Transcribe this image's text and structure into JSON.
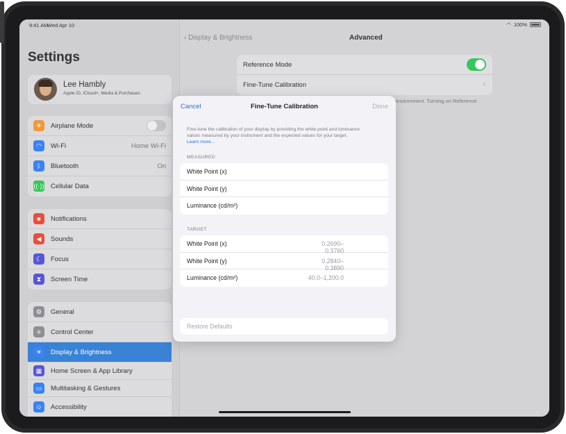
{
  "status_bar": {
    "time": "9:41 AM",
    "date": "Wed Apr 10",
    "battery": "100%"
  },
  "sidebar": {
    "title": "Settings",
    "profile": {
      "name": "Lee Hambly",
      "subtitle": "Apple ID, iCloud+, Media & Purchases"
    },
    "group1": [
      {
        "label": "Airplane Mode",
        "icon": "airplane-icon",
        "color": "#f09a37",
        "toggle": false
      },
      {
        "label": "Wi-Fi",
        "icon": "wifi-icon",
        "color": "#3a82f6",
        "value": "Home Wi-Fi"
      },
      {
        "label": "Bluetooth",
        "icon": "bluetooth-icon",
        "color": "#3a82f6",
        "value": "On"
      },
      {
        "label": "Cellular Data",
        "icon": "cellular-icon",
        "color": "#34c759"
      }
    ],
    "group2": [
      {
        "label": "Notifications",
        "icon": "bell-icon",
        "color": "#eb4d3d"
      },
      {
        "label": "Sounds",
        "icon": "speaker-icon",
        "color": "#eb4d3d"
      },
      {
        "label": "Focus",
        "icon": "moon-icon",
        "color": "#5856d6"
      },
      {
        "label": "Screen Time",
        "icon": "hourglass-icon",
        "color": "#5856d6"
      }
    ],
    "group3": [
      {
        "label": "General",
        "icon": "gear-icon",
        "color": "#8e8e93"
      },
      {
        "label": "Control Center",
        "icon": "toggles-icon",
        "color": "#8e8e93"
      },
      {
        "label": "Display & Brightness",
        "icon": "sun-icon",
        "color": "#3a82f6",
        "selected": true
      },
      {
        "label": "Home Screen & App Library",
        "icon": "grid-icon",
        "color": "#5856d6"
      },
      {
        "label": "Multitasking & Gestures",
        "icon": "multitask-icon",
        "color": "#3a82f6"
      },
      {
        "label": "Accessibility",
        "icon": "accessibility-icon",
        "color": "#3a82f6"
      }
    ]
  },
  "detail": {
    "back_label": "Display & Brightness",
    "title": "Advanced",
    "reference_mode_label": "Reference Mode",
    "reference_mode_on": true,
    "fine_tune_label": "Fine-Tune Calibration",
    "footnote": "environment. Turning on Reference"
  },
  "modal": {
    "cancel": "Cancel",
    "title": "Fine-Tune Calibration",
    "done": "Done",
    "description": "Fine-tune the calibration of your display by providing the white point and luminance values measured by your instrument and the expected values for your target.",
    "learn_more": "Learn more...",
    "measured_header": "MEASURED",
    "measured": [
      {
        "label": "White Point (x)"
      },
      {
        "label": "White Point (y)"
      },
      {
        "label": "Luminance (cd/m²)"
      }
    ],
    "target_header": "TARGET",
    "target": [
      {
        "label": "White Point (x)",
        "value": "0.2690–0.3760"
      },
      {
        "label": "White Point (y)",
        "value": "0.2840–0.3890"
      },
      {
        "label": "Luminance (cd/m²)",
        "value": "40.0–1,200.0"
      }
    ],
    "restore_label": "Restore Defaults"
  }
}
